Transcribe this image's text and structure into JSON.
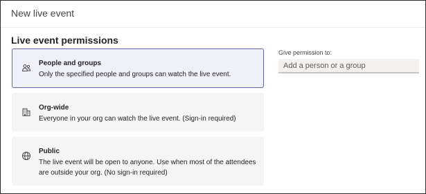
{
  "dialog": {
    "title": "New live event"
  },
  "permissions": {
    "section_title": "Live event permissions",
    "options": [
      {
        "name": "People and groups",
        "description": "Only the specified people and groups can watch the live event.",
        "icon": "people-icon",
        "selected": true
      },
      {
        "name": "Org-wide",
        "description": "Everyone in your org can watch the live event. (Sign-in required)",
        "icon": "building-icon",
        "selected": false
      },
      {
        "name": "Public",
        "description": "The live event will be open to anyone. Use when most of the attendees are outside your org. (No sign-in required)",
        "icon": "globe-icon",
        "selected": false
      }
    ]
  },
  "give_permission": {
    "label": "Give permission to:",
    "placeholder": "Add a person or a group",
    "value": ""
  },
  "colors": {
    "accent": "#6264a7",
    "selected_bg": "#eff0f9",
    "option_bg": "#f5f5f5",
    "input_bg": "#f3f2f1"
  }
}
